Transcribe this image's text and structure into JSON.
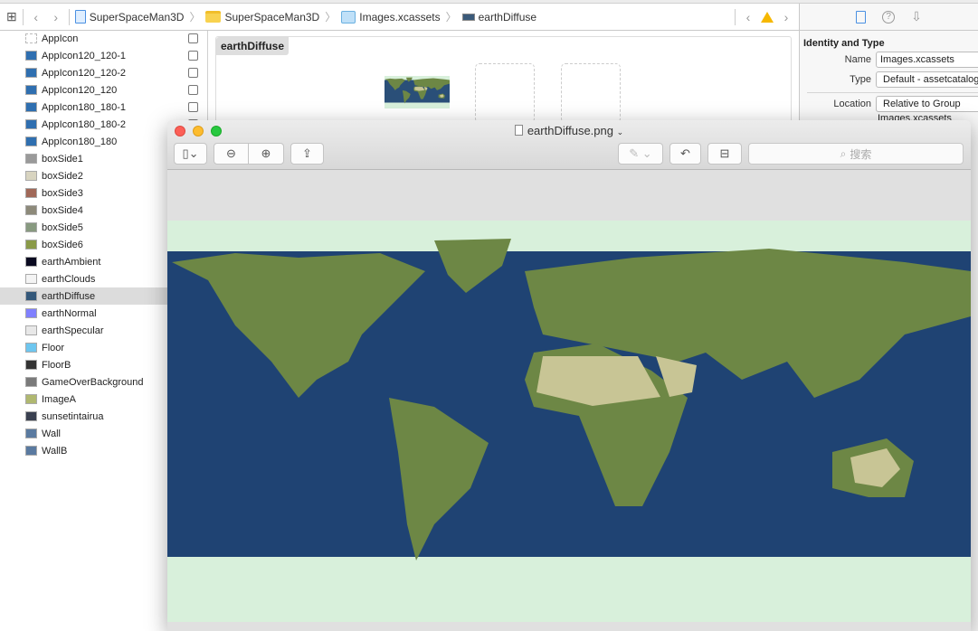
{
  "toolbar": {
    "breadcrumbs": [
      {
        "label": "SuperSpaceMan3D",
        "icon": "project-icon"
      },
      {
        "label": "SuperSpaceMan3D",
        "icon": "folder-icon"
      },
      {
        "label": "Images.xcassets",
        "icon": "asset-catalog-icon"
      },
      {
        "label": "earthDiffuse",
        "icon": "image-set-icon"
      }
    ]
  },
  "sidebar": {
    "items": [
      {
        "label": "AppIcon",
        "thumb": "#ffffff"
      },
      {
        "label": "AppIcon120_120-1",
        "thumb": "#2f6fb0"
      },
      {
        "label": "AppIcon120_120-2",
        "thumb": "#2f6fb0"
      },
      {
        "label": "AppIcon120_120",
        "thumb": "#2f6fb0"
      },
      {
        "label": "AppIcon180_180-1",
        "thumb": "#2f6fb0"
      },
      {
        "label": "AppIcon180_180-2",
        "thumb": "#2f6fb0"
      },
      {
        "label": "AppIcon180_180",
        "thumb": "#2f6fb0"
      },
      {
        "label": "boxSide1",
        "thumb": "#9a9a9a"
      },
      {
        "label": "boxSide2",
        "thumb": "#d8d4c0"
      },
      {
        "label": "boxSide3",
        "thumb": "#a06858"
      },
      {
        "label": "boxSide4",
        "thumb": "#8d8a7a"
      },
      {
        "label": "boxSide5",
        "thumb": "#889a80"
      },
      {
        "label": "boxSide6",
        "thumb": "#8a9a48"
      },
      {
        "label": "earthAmbient",
        "thumb": "#0a0a20"
      },
      {
        "label": "earthClouds",
        "thumb": "#f4f4f4"
      },
      {
        "label": "earthDiffuse",
        "thumb": "#34587a",
        "selected": true
      },
      {
        "label": "earthNormal",
        "thumb": "#8080ff"
      },
      {
        "label": "earthSpecular",
        "thumb": "#e8e8e8"
      },
      {
        "label": "Floor",
        "thumb": "#6ec6ef"
      },
      {
        "label": "FloorB",
        "thumb": "#333333"
      },
      {
        "label": "GameOverBackground",
        "thumb": "#7a7a7a"
      },
      {
        "label": "ImageA",
        "thumb": "#b0b870"
      },
      {
        "label": "sunsetintairua",
        "thumb": "#3a4050"
      },
      {
        "label": "Wall",
        "thumb": "#5a7aa0"
      },
      {
        "label": "WallB",
        "thumb": "#5a7aa0"
      }
    ]
  },
  "editor": {
    "title": "earthDiffuse"
  },
  "inspector": {
    "section": "Identity and Type",
    "name_label": "Name",
    "name_value": "Images.xcassets",
    "type_label": "Type",
    "type_value": "Default - assetcatalog",
    "location_label": "Location",
    "location_value": "Relative to Group",
    "path_value": "Images.xcassets"
  },
  "preview": {
    "title": "earthDiffuse.png",
    "search_placeholder": "搜索"
  },
  "colors": {
    "ocean": "#1f4373",
    "land": "#6d8745",
    "desert": "#c8c595",
    "ice": "#d8f0db",
    "accent": "#4a90e2",
    "warning": "#f6b800"
  }
}
